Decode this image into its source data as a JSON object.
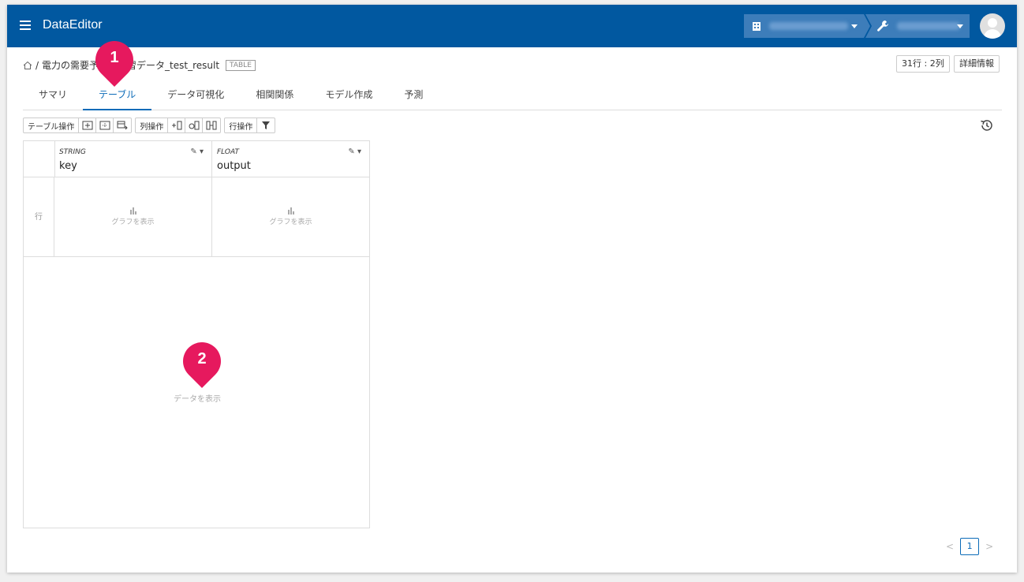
{
  "header": {
    "app_title": "DataEditor",
    "org_selector_icon": "building-icon",
    "project_selector_icon": "wrench-icon"
  },
  "breadcrumb": {
    "home_icon": "home-icon",
    "separator": "/",
    "dataset_name": "電力の需要予測用学習データ_test_result",
    "type_tag": "TABLE"
  },
  "top_buttons": {
    "size": "31行 : 2列",
    "details": "詳細情報"
  },
  "tabs": [
    {
      "label": "サマリ"
    },
    {
      "label": "テーブル"
    },
    {
      "label": "データ可視化"
    },
    {
      "label": "相関関係"
    },
    {
      "label": "モデル作成"
    },
    {
      "label": "予測"
    }
  ],
  "toolbar": {
    "table_ops": "テーブル操作",
    "column_ops": "列操作",
    "row_ops": "行操作"
  },
  "grid": {
    "columns": [
      {
        "type": "STRING",
        "name": "key"
      },
      {
        "type": "FLOAT",
        "name": "output"
      }
    ],
    "row_label": "行",
    "graph_label": "グラフを表示",
    "empty_label": "データを表示"
  },
  "annotations": {
    "pin1": "1",
    "pin2": "2"
  },
  "pagination": {
    "current_page": "1"
  },
  "colors": {
    "header_bg": "#0158a0",
    "accent": "#0b6bb8",
    "pin": "#e6195e"
  }
}
